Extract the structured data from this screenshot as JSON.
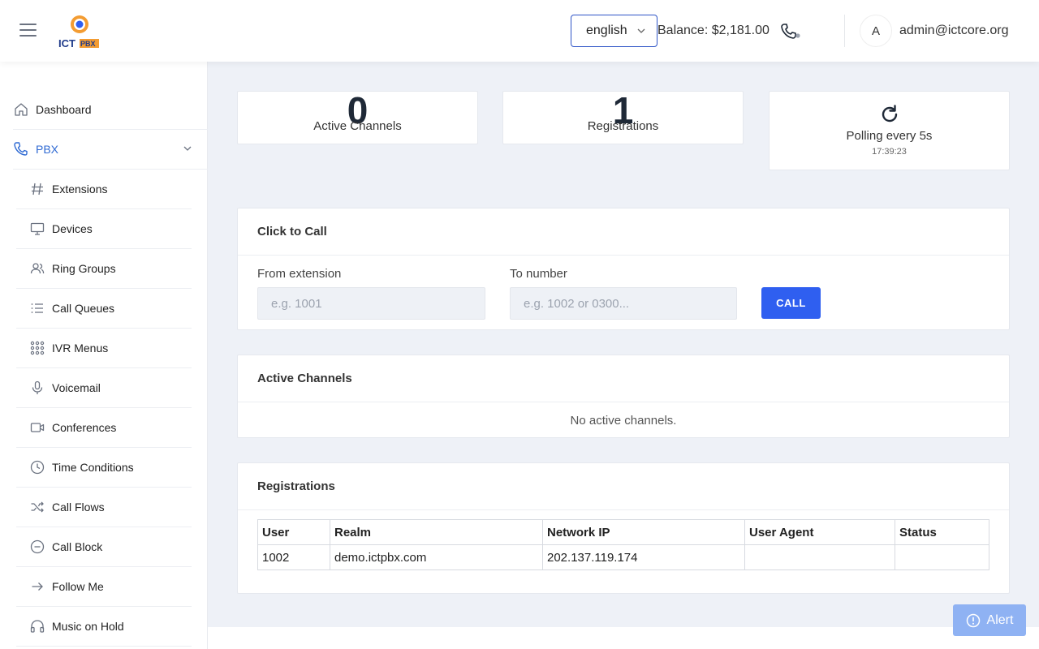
{
  "header": {
    "language": "english",
    "balance": "Balance: $2,181.00",
    "avatar_initial": "A",
    "user_email": "admin@ictcore.org"
  },
  "sidebar": {
    "items": [
      {
        "label": "Dashboard",
        "icon": "home-icon"
      },
      {
        "label": "PBX",
        "icon": "phone-icon",
        "expanded": true
      },
      {
        "label": "Extensions",
        "icon": "hash-icon"
      },
      {
        "label": "Devices",
        "icon": "monitor-icon"
      },
      {
        "label": "Ring Groups",
        "icon": "users-icon"
      },
      {
        "label": "Call Queues",
        "icon": "list-icon"
      },
      {
        "label": "IVR Menus",
        "icon": "grid-icon"
      },
      {
        "label": "Voicemail",
        "icon": "mic-icon"
      },
      {
        "label": "Conferences",
        "icon": "video-icon"
      },
      {
        "label": "Time Conditions",
        "icon": "clock-icon"
      },
      {
        "label": "Call Flows",
        "icon": "shuffle-icon"
      },
      {
        "label": "Call Block",
        "icon": "minus-circle-icon"
      },
      {
        "label": "Follow Me",
        "icon": "arrow-right-icon"
      },
      {
        "label": "Music on Hold",
        "icon": "headphones-icon"
      }
    ]
  },
  "stats": {
    "active_channels": {
      "value": "0",
      "label": "Active Channels"
    },
    "registrations": {
      "value": "1",
      "label": "Registrations"
    },
    "polling": {
      "label": "Polling every 5s",
      "time": "17:39:23"
    }
  },
  "click_to_call": {
    "title": "Click to Call",
    "from_label": "From extension",
    "from_placeholder": "e.g. 1001",
    "to_label": "To number",
    "to_placeholder": "e.g. 1002 or 0300...",
    "button": "CALL"
  },
  "active_channels_panel": {
    "title": "Active Channels",
    "empty": "No active channels."
  },
  "registrations_panel": {
    "title": "Registrations",
    "columns": [
      "User",
      "Realm",
      "Network IP",
      "User Agent",
      "Status"
    ],
    "rows": [
      [
        "1002",
        "demo.ictpbx.com",
        "202.137.119.174",
        "",
        ""
      ]
    ]
  },
  "alert": {
    "label": "Alert"
  },
  "colors": {
    "primary": "#2f5ff0",
    "accent_nav": "#2f6ad3",
    "background": "#eef1f7"
  }
}
